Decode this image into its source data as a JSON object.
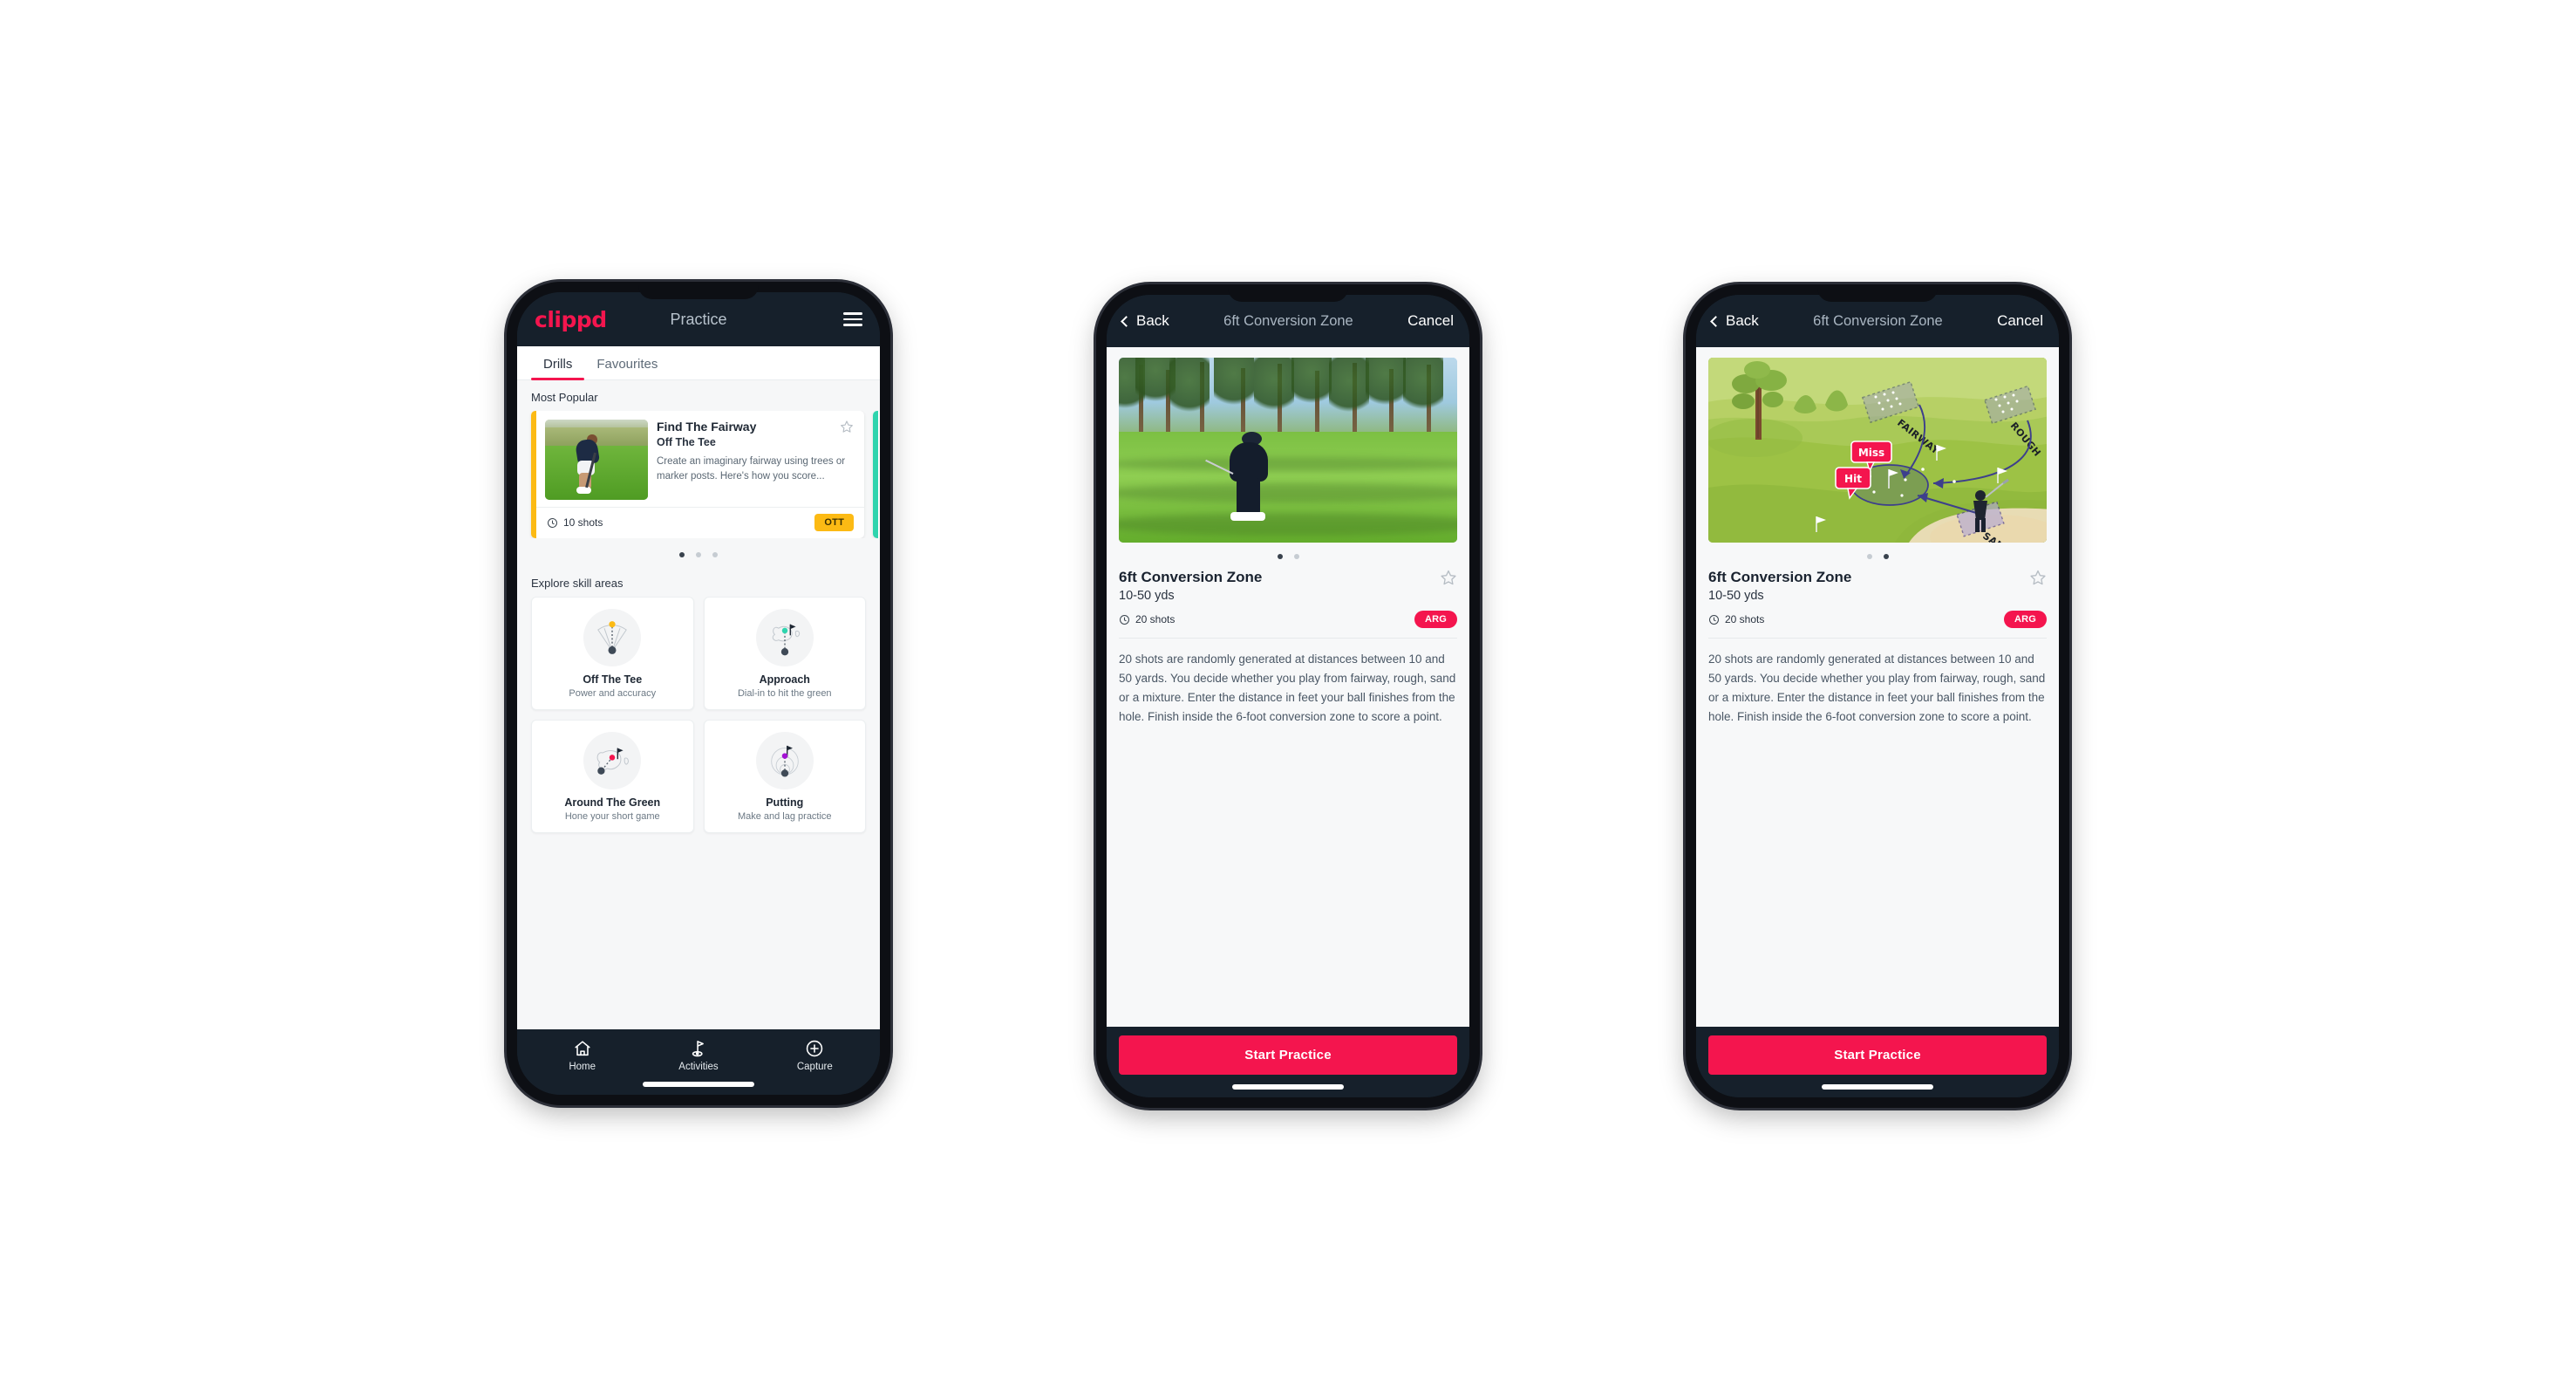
{
  "brand": {
    "logo_text": "clippd",
    "accent_pink": "#f4154e",
    "dark_navy": "#16202b",
    "amber": "#fcba14",
    "teal": "#2fd4ae"
  },
  "phone1": {
    "header": {
      "title": "Practice",
      "menu_icon": "hamburger-icon"
    },
    "tabs": [
      {
        "label": "Drills",
        "active": true
      },
      {
        "label": "Favourites",
        "active": false
      }
    ],
    "most_popular_label": "Most Popular",
    "drill_card": {
      "title": "Find The Fairway",
      "subtitle": "Off The Tee",
      "description": "Create an imaginary fairway using trees or marker posts. Here's how you score...",
      "shots": "10 shots",
      "badge": "OTT",
      "accent_color": "#fcba14",
      "star_icon": "star-outline-icon",
      "shots_icon": "shots-clock-icon",
      "thumbnail": "golfer-teeing-off-photo"
    },
    "next_card_accent": "#2fd4ae",
    "carousel_dots": {
      "count": 3,
      "active_index": 0
    },
    "explore_label": "Explore skill areas",
    "skill_areas": [
      {
        "name": "Off The Tee",
        "desc": "Power and accuracy",
        "icon": "tee-dispersion-icon",
        "dot_color": "#fcba14"
      },
      {
        "name": "Approach",
        "desc": "Dial-in to hit the green",
        "icon": "approach-green-icon",
        "dot_color": "#2fd4ae"
      },
      {
        "name": "Around The Green",
        "desc": "Hone your short game",
        "icon": "around-green-icon",
        "dot_color": "#f4154e"
      },
      {
        "name": "Putting",
        "desc": "Make and lag practice",
        "icon": "putting-rings-icon",
        "dot_color": "#a413d4"
      }
    ],
    "bottom_nav": [
      {
        "label": "Home",
        "icon": "home-icon",
        "active": false
      },
      {
        "label": "Activities",
        "icon": "golf-flag-icon",
        "active": true
      },
      {
        "label": "Capture",
        "icon": "plus-circle-icon",
        "active": false
      }
    ]
  },
  "detail_header": {
    "back": "Back",
    "title": "6ft Conversion Zone",
    "cancel": "Cancel",
    "back_icon": "chevron-left-icon"
  },
  "drill_detail": {
    "title": "6ft Conversion Zone",
    "yardage": "10-50 yds",
    "shots": "20 shots",
    "badge": "ARG",
    "shots_icon": "shots-clock-icon",
    "star_icon": "star-outline-icon",
    "description": "20 shots are randomly generated at distances between 10 and 50 yards. You decide whether you play from fairway, rough, sand or a mixture. Enter the distance in feet your ball finishes from the hole. Finish inside the 6-foot conversion zone to score a point.",
    "start_button": "Start Practice"
  },
  "phone2": {
    "media": "golfer-chipping-photo",
    "dots": {
      "count": 2,
      "active_index": 0
    }
  },
  "phone3": {
    "media": "golf-course-illustration",
    "dots": {
      "count": 2,
      "active_index": 1
    },
    "illustration_labels": {
      "fairway": "FAIRWAY",
      "rough": "ROUGH",
      "sand": "SAND",
      "miss": "Miss",
      "hit": "Hit"
    }
  }
}
